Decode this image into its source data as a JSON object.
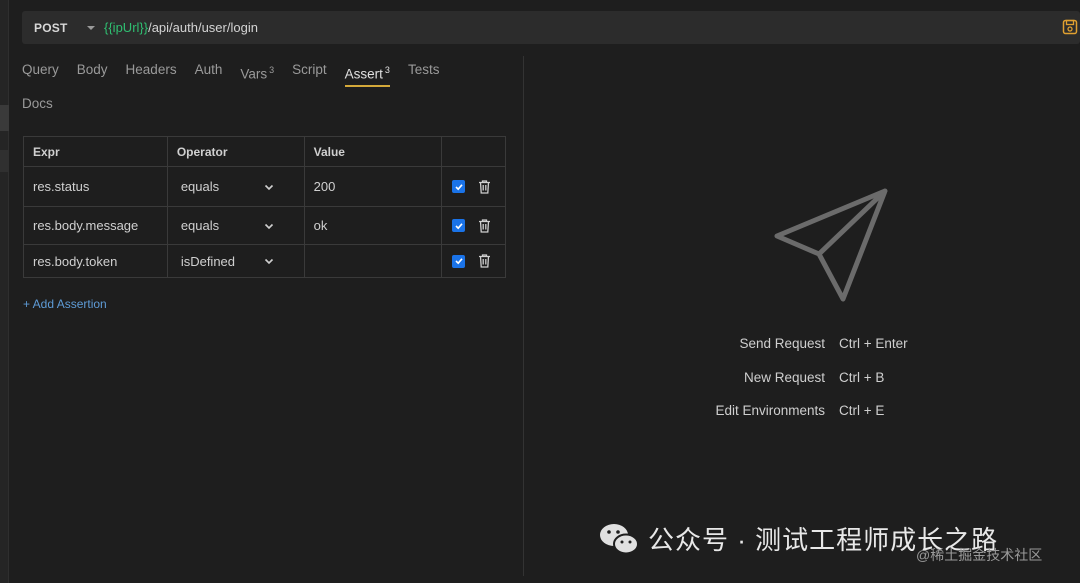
{
  "request": {
    "method": "POST",
    "url_variable": "{{ipUrl}}",
    "url_path": "/api/auth/user/login"
  },
  "tabs": [
    {
      "label": "Query"
    },
    {
      "label": "Body"
    },
    {
      "label": "Headers"
    },
    {
      "label": "Auth"
    },
    {
      "label": "Vars",
      "badge": "3"
    },
    {
      "label": "Script"
    },
    {
      "label": "Assert",
      "badge": "3"
    },
    {
      "label": "Tests"
    },
    {
      "label": "Docs"
    }
  ],
  "active_tab": "Assert",
  "assert_table": {
    "headers": [
      "Expr",
      "Operator",
      "Value",
      ""
    ],
    "rows": [
      {
        "expr": "res.status",
        "operator": "equals",
        "value": "200",
        "enabled": true
      },
      {
        "expr": "res.body.message",
        "operator": "equals",
        "value": "ok",
        "enabled": true
      },
      {
        "expr": "res.body.token",
        "operator": "isDefined",
        "value": "",
        "enabled": true
      }
    ]
  },
  "add_assertion_label": "+ Add Assertion",
  "shortcuts": [
    {
      "label": "Send Request",
      "keys": "Ctrl + Enter"
    },
    {
      "label": "New Request",
      "keys": "Ctrl + B"
    },
    {
      "label": "Edit Environments",
      "keys": "Ctrl + E"
    }
  ],
  "watermark": {
    "text": "公众号 · 测试工程师成长之路",
    "sub": "@稀土掘金技术社区"
  },
  "colors": {
    "accent_tab": "#d4a93a",
    "url_variable": "#2fbf71",
    "checkbox": "#1a73e8",
    "link": "#5e9bd6",
    "save_icon": "#e0a030"
  },
  "icons": {
    "method_dropdown": "chevron-down-icon",
    "save": "save-icon",
    "operator_dropdown": "chevron-down-icon",
    "enabled": "checkbox-icon",
    "delete": "trash-icon",
    "empty_state": "paper-plane-icon",
    "watermark": "wechat-icon"
  }
}
